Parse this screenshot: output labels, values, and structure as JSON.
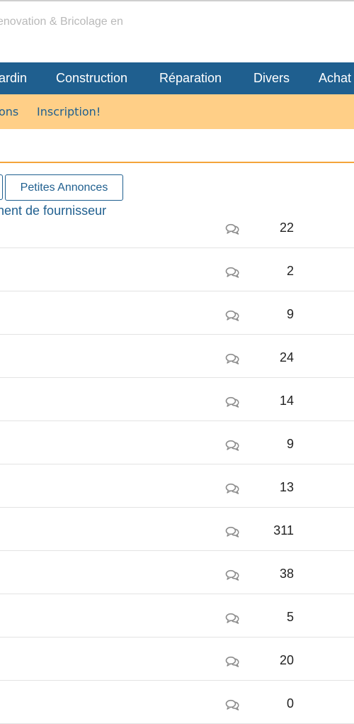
{
  "header": {
    "tagline": "enovation & Bricolage en"
  },
  "nav": {
    "items": [
      "ardin",
      "Construction",
      "Réparation",
      "Divers",
      "Achat"
    ]
  },
  "subnav": {
    "links": [
      "ons",
      "Inscription!"
    ]
  },
  "buttons": {
    "annonces": "Petites Annonces"
  },
  "topics": {
    "first_title": "nent de fournisseur",
    "reply_counts": [
      "22",
      "2",
      "9",
      "24",
      "14",
      "9",
      "13",
      "311",
      "38",
      "5",
      "20",
      "0"
    ]
  },
  "icons": {
    "replies": "speech-bubbles-icon"
  }
}
